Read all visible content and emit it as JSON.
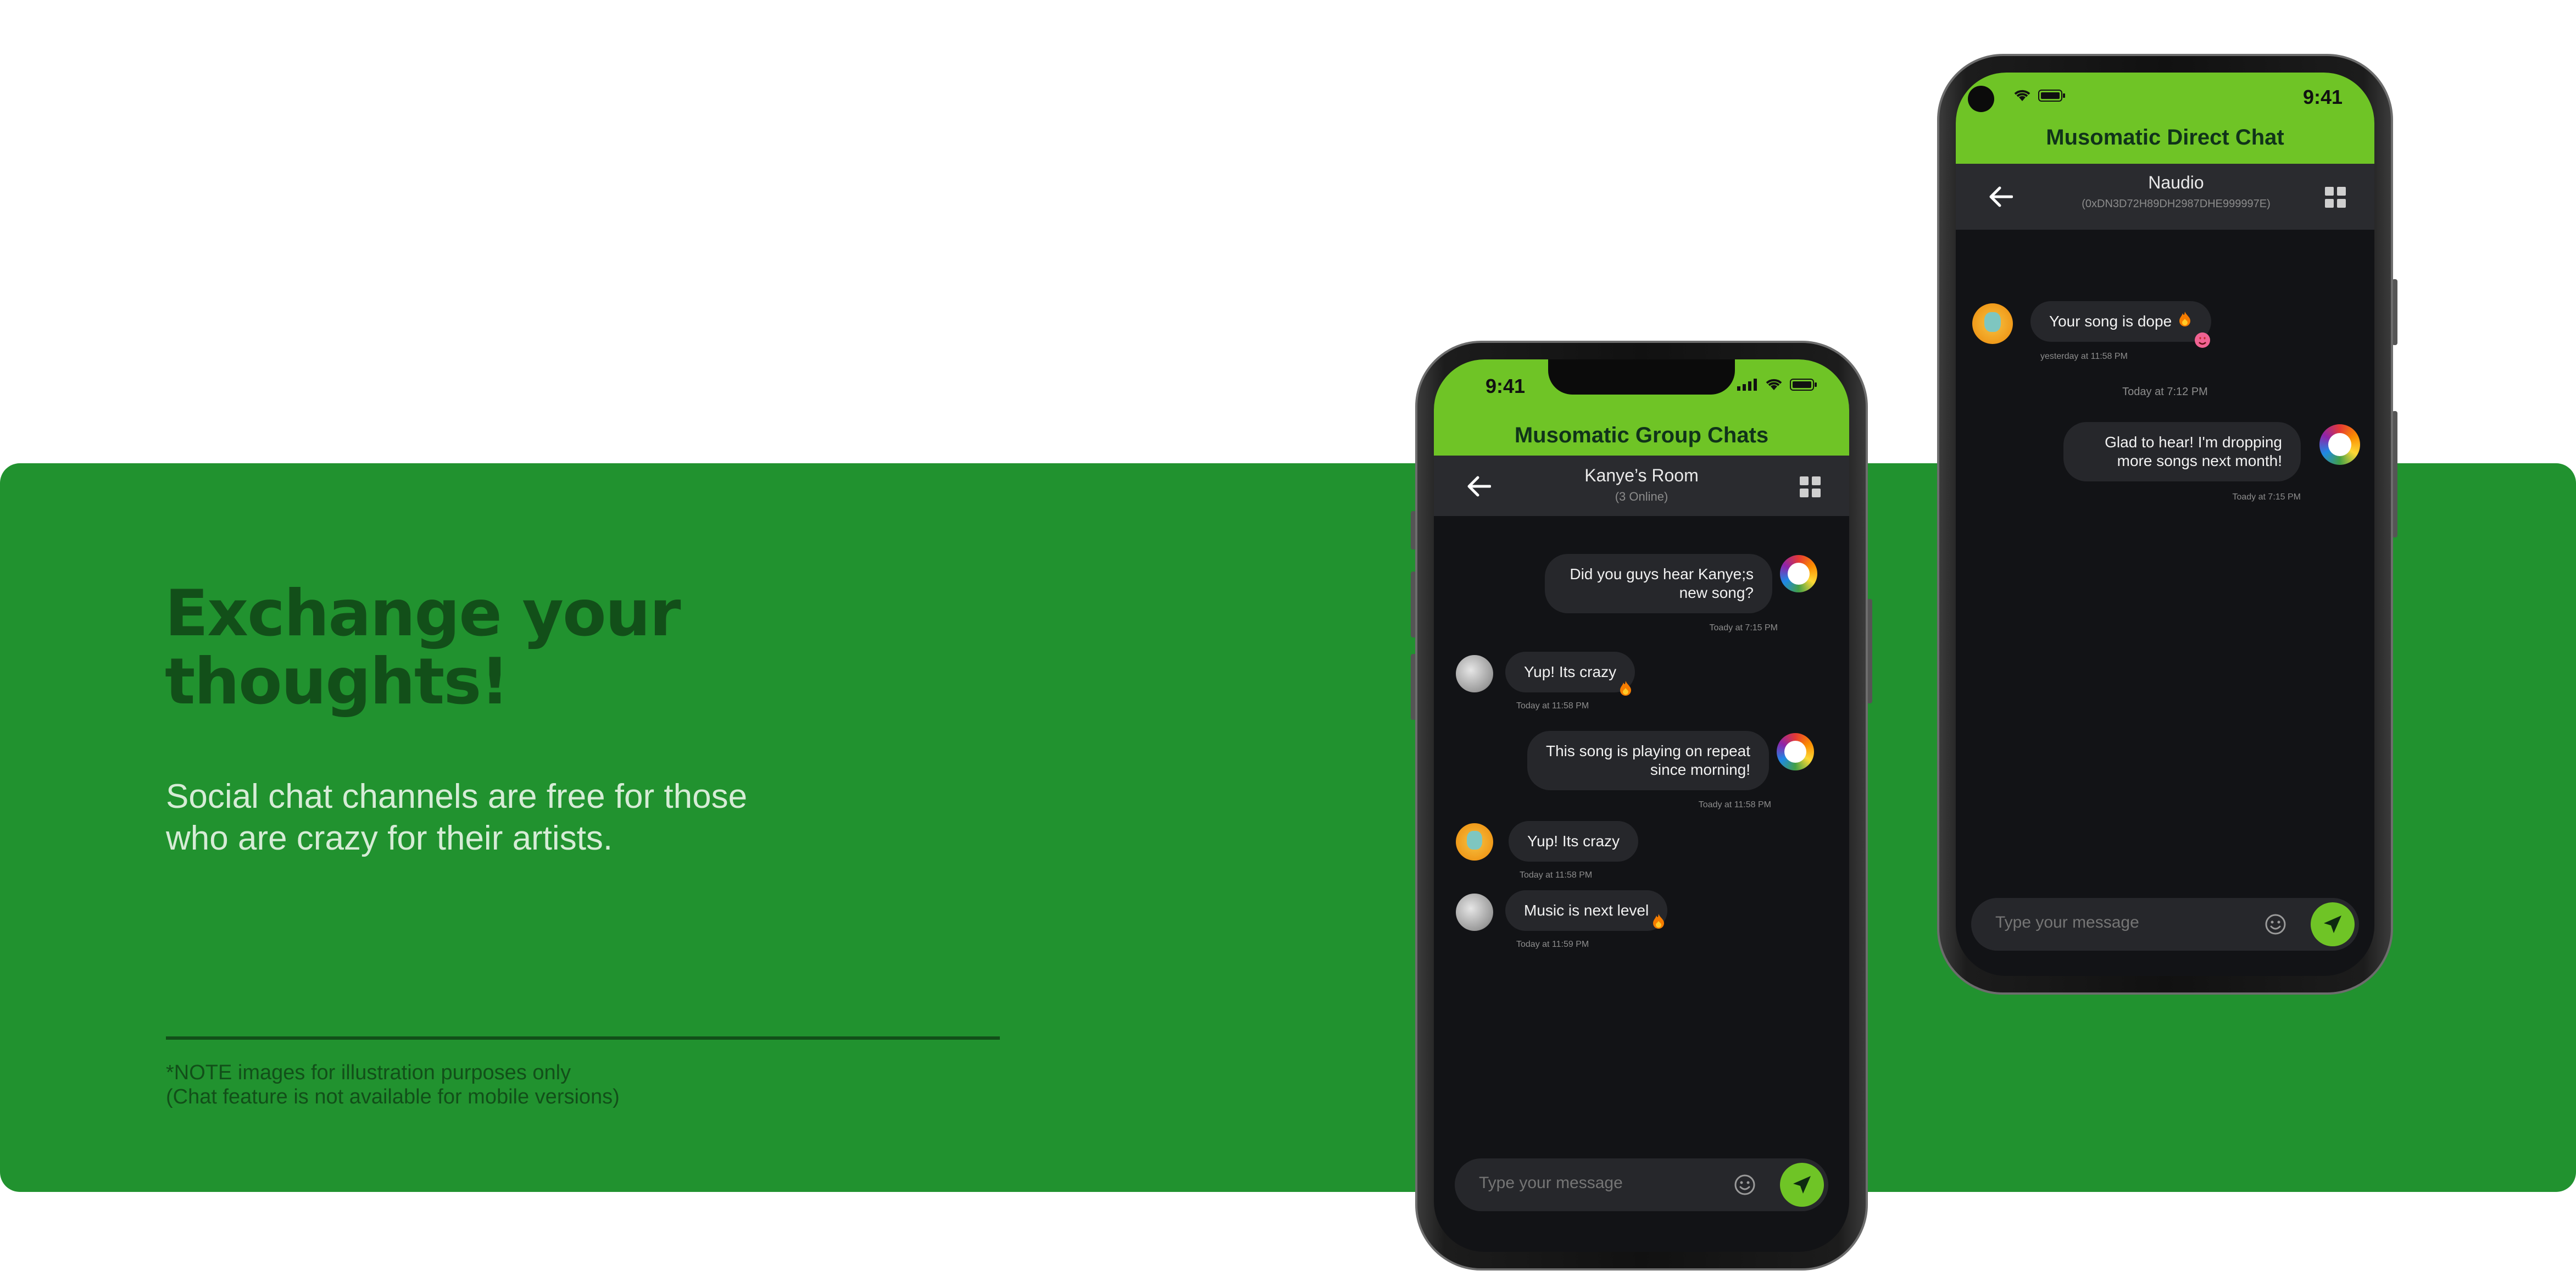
{
  "banner": {
    "headline_line1": "Exchange your",
    "headline_line2": "thoughts!",
    "sub_line1": "Social chat channels are free for those",
    "sub_line2": "who are crazy for their artists.",
    "note_line1": "*NOTE images for illustration purposes only",
    "note_line2": "(Chat feature is not available for mobile versions)"
  },
  "colors": {
    "banner_bg": "#21922f",
    "headline": "#124f19",
    "accent_green": "#6fc426",
    "chat_bg": "#121316",
    "bubble_bg": "#26272b"
  },
  "group_phone": {
    "status_time": "9:41",
    "app_title": "Musomatic Group Chats",
    "room_title": "Kanye’s Room",
    "room_sub": "(3 Online)",
    "messages": [
      {
        "side": "right",
        "text_line1": "Did you guys hear Kanye;s",
        "text_line2": "new song?",
        "time": "Toady at 7:15 PM",
        "avatar": "rainbow-avatar"
      },
      {
        "side": "left",
        "text_line1": "Yup! Its crazy",
        "time": "Today at 11:58 PM",
        "avatar": "grey-avatar",
        "reaction": "fire"
      },
      {
        "side": "right",
        "text_line1": "This song is playing on repeat",
        "text_line2": "since morning!",
        "time": "Toady at 11:58 PM",
        "avatar": "rainbow-avatar"
      },
      {
        "side": "left",
        "text_line1": "Yup! Its crazy",
        "time": "Today at 11:58 PM",
        "avatar": "orange-avatar"
      },
      {
        "side": "left",
        "text_line1": "Music is next level",
        "time": "Today at 11:59 PM",
        "avatar": "grey-avatar",
        "reaction": "fire"
      }
    ],
    "composer_placeholder": "Type your message"
  },
  "direct_phone": {
    "status_time": "9:41",
    "app_title": "Musomatic Direct Chat",
    "contact_name": "Naudio",
    "contact_address": "(0xDN3D72H89DH2987DHE999997E)",
    "messages": [
      {
        "side": "left",
        "text_line1": "Your song is dope",
        "time": "yesterday at 11:58 PM",
        "avatar": "orange-avatar",
        "reaction": "heart-eyes"
      },
      {
        "side": "right",
        "text_line1": "Glad to hear! I'm dropping",
        "text_line2": "more songs next month!",
        "time": "Toady at 7:15 PM",
        "avatar": "rainbow-avatar"
      }
    ],
    "day_separator": "Today at 7:12 PM",
    "composer_placeholder": "Type your message"
  }
}
